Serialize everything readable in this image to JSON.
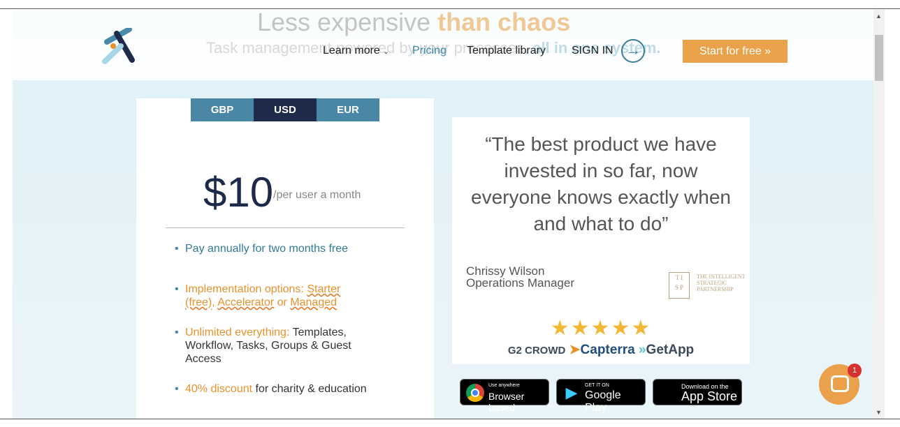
{
  "background": {
    "headline": "Less expensive",
    "headline_accent": "than chaos",
    "subheadline": "Task management powered by your processes,",
    "subheadline_accent": "all in one system."
  },
  "nav": {
    "learn_more": "Learn more",
    "pricing": "Pricing",
    "template_library": "Template library",
    "sign_in": "SIGN IN",
    "cta": "Start for free »"
  },
  "pricing": {
    "currencies": [
      "GBP",
      "USD",
      "EUR"
    ],
    "selected": "USD",
    "price": "$10",
    "period": "/per user a month",
    "features": [
      {
        "a": "Pay annually for two months free"
      },
      {
        "a": "Implementation options: ",
        "b": "Starter (free)",
        "c": ", ",
        "d": "Accelerator",
        "e": " or ",
        "f": "Managed"
      },
      {
        "a": "Unlimited everything:",
        "b": " Templates, Workflow, Tasks, Groups & Guest Access"
      },
      {
        "a": "40% discount",
        "b": " for charity & education"
      }
    ]
  },
  "testimonial": {
    "quote": "“The best product we have invested in so far, now everyone knows exactly when and what to do”",
    "name": "Chrissy Wilson",
    "role": "Operations Manager",
    "company_logo": "THE INTELLIGENT STRATEGIC PARTNERSHIP",
    "rating": 5,
    "review_sites": [
      "G2 CROWD",
      "Capterra",
      "GetApp"
    ]
  },
  "badges": [
    {
      "small": "Use anywhere",
      "large": "Browser based",
      "icon": "chrome-icon"
    },
    {
      "small": "GET IT ON",
      "large": "Google Play",
      "icon": "google-play-icon"
    },
    {
      "small": "Download on the",
      "large": "App Store",
      "icon": "apple-icon"
    }
  ],
  "chat": {
    "unread": "1"
  },
  "colors": {
    "accent": "#e9a24a",
    "brand": "#3a7d96",
    "navy": "#1d2a4a"
  }
}
